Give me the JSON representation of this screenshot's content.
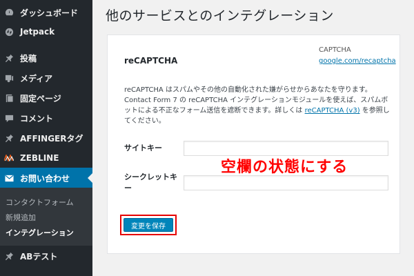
{
  "sidebar": {
    "items": [
      {
        "label": "ダッシュボード",
        "icon": "dashboard-icon"
      },
      {
        "label": "Jetpack",
        "icon": "jetpack-icon"
      },
      {
        "label": "投稿",
        "icon": "pin-icon"
      },
      {
        "label": "メディア",
        "icon": "media-icon"
      },
      {
        "label": "固定ページ",
        "icon": "page-icon"
      },
      {
        "label": "コメント",
        "icon": "comment-icon"
      },
      {
        "label": "AFFINGERタグ",
        "icon": "pin-icon"
      },
      {
        "label": "ZEBLINE",
        "icon": "zebline-icon"
      },
      {
        "label": "お問い合わせ",
        "icon": "mail-icon"
      },
      {
        "label": "ABテスト",
        "icon": "pin-icon"
      }
    ],
    "submenu": [
      {
        "label": "コンタクトフォーム"
      },
      {
        "label": "新規追加"
      },
      {
        "label": "インテグレーション"
      }
    ]
  },
  "page": {
    "title": "他のサービスとのインテグレーション"
  },
  "card": {
    "title": "reCAPTCHA",
    "cap_label": "CAPTCHA",
    "link": "google.com/recaptcha",
    "desc_main": "reCAPTCHA はスパムやその他の自動化された嫌がらせからあなたを守ります。Contact Form 7 の reCAPTCHA インテグレーションモジュールを使えば、スパムボットによる不正なフォーム送信を遮断できます。詳しくは ",
    "desc_link": "reCAPTCHA (v3)",
    "desc_tail": " を参照してください。",
    "site_key_label": "サイトキー",
    "site_key_value": "",
    "secret_key_label": "シークレットキー",
    "secret_key_value": "",
    "save_label": "変更を保存"
  },
  "annotation": {
    "text": "空欄の状態にする",
    "color": "#ff0000"
  },
  "colors": {
    "sidebar_bg": "#23282d",
    "active": "#0073aa",
    "button": "#0085ba"
  }
}
